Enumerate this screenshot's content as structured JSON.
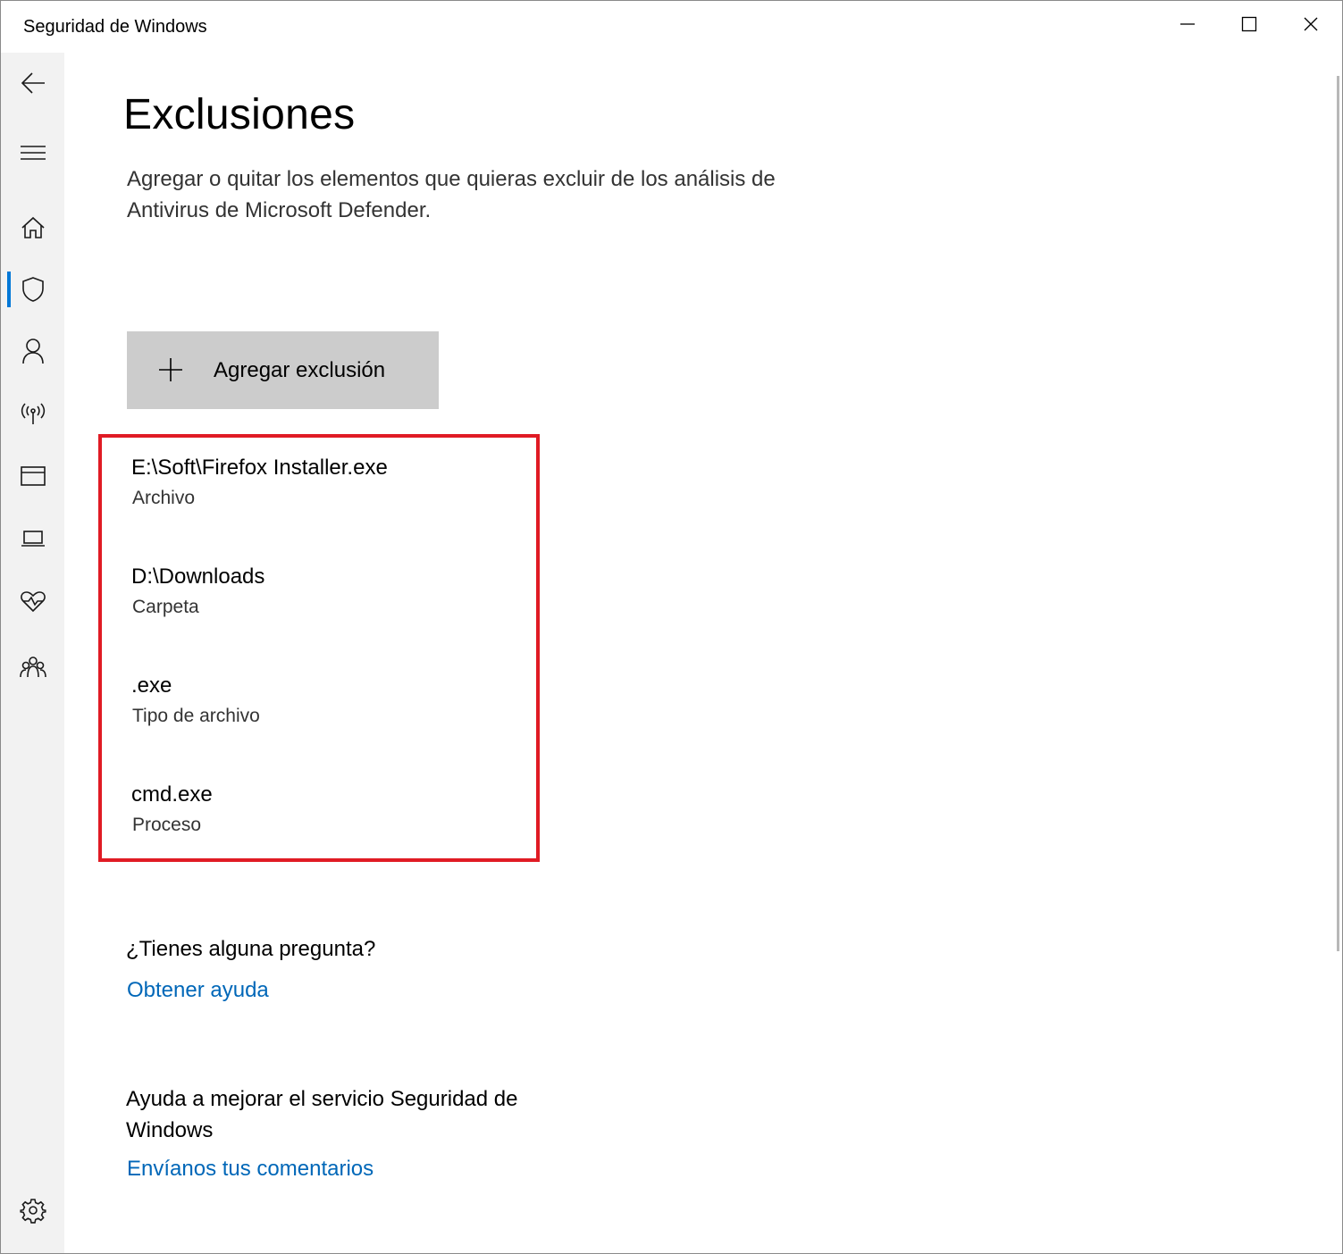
{
  "window": {
    "title": "Seguridad de Windows"
  },
  "sidebar": {
    "items": [
      {
        "icon": "back-arrow-icon"
      },
      {
        "icon": "hamburger-menu-icon"
      },
      {
        "icon": "home-icon"
      },
      {
        "icon": "shield-icon",
        "active": true
      },
      {
        "icon": "person-icon"
      },
      {
        "icon": "wireless-antenna-icon"
      },
      {
        "icon": "app-browser-icon"
      },
      {
        "icon": "laptop-icon"
      },
      {
        "icon": "heart-pulse-icon"
      },
      {
        "icon": "family-icon"
      },
      {
        "icon": "gear-icon"
      }
    ],
    "accent_color": "#0078d7"
  },
  "main": {
    "title": "Exclusiones",
    "description": "Agregar o quitar los elementos que quieras excluir de los análisis de Antivirus de Microsoft Defender.",
    "add_button_label": "Agregar exclusión",
    "exclusions": [
      {
        "path": "E:\\Soft\\Firefox Installer.exe",
        "type": "Archivo"
      },
      {
        "path": "D:\\Downloads",
        "type": "Carpeta"
      },
      {
        "path": ".exe",
        "type": "Tipo de archivo"
      },
      {
        "path": "cmd.exe",
        "type": "Proceso"
      }
    ],
    "question_heading": "¿Tienes alguna pregunta?",
    "help_link": "Obtener ayuda",
    "improve_heading": "Ayuda a mejorar el servicio Seguridad de Windows",
    "feedback_link": "Envíanos tus comentarios",
    "highlight_color": "#e01b24",
    "link_color": "#0067b8"
  }
}
